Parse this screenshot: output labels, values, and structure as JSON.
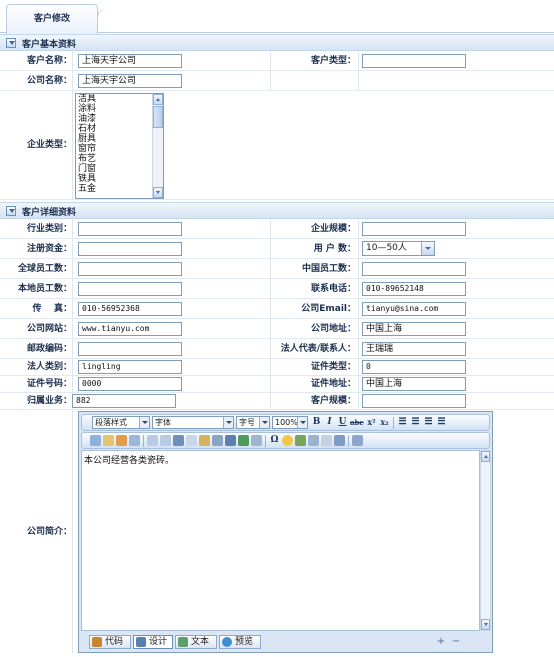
{
  "tab": {
    "title": "客户修改"
  },
  "sections": {
    "basic": "客户基本资料",
    "detail": "客户详细资料"
  },
  "basic": {
    "customer_name_label": "客户名称：",
    "customer_name": "上海天宇公司",
    "customer_type_label": "客户类型：",
    "customer_type": "",
    "company_name_label": "公司名称：",
    "company_name": "上海天宇公司",
    "industry_type_label": "企业类型：",
    "industry_options": [
      "洁具",
      "涂料",
      "油漆",
      "石材",
      "厨具",
      "窗帘",
      "布艺",
      "门窗",
      "铁具",
      "五金"
    ]
  },
  "detail": {
    "industry_label": "行业类别：",
    "industry": "",
    "scale_label": "企业规模：",
    "scale": "",
    "capital_label": "注册资金：",
    "capital": "",
    "users_label": "用 户 数：",
    "users": "10—50人",
    "global_staff_label": "全球员工数：",
    "global_staff": "",
    "china_staff_label": "中国员工数：",
    "china_staff": "",
    "local_staff_label": "本地员工数：",
    "local_staff": "",
    "phone_label": "联系电话：",
    "phone": "010-89652148",
    "fax_label": "传    真：",
    "fax": "010-56952368",
    "email_label": "公司Email：",
    "email": "tianyu@sina.com",
    "website_label": "公司网站：",
    "website": "www.tianyu.com",
    "address_label": "公司地址：",
    "address": "中国上海",
    "zip_label": "邮政编码：",
    "zip": "",
    "legal_label": "法人代表/联系人：",
    "legal": "王瑞瑞",
    "legal_type_label": "法人类别：",
    "legal_type": "lingling",
    "cert_type_label": "证件类型：",
    "cert_type": "0",
    "cert_no_label": "证件号码：",
    "cert_no": "0000",
    "cert_addr_label": "证件地址：",
    "cert_addr": "中国上海",
    "owner_label": "归属业务：",
    "owner": "882",
    "cust_scale_label": "客户规模：",
    "cust_scale": "",
    "intro_label": "公司简介："
  },
  "editor": {
    "para_style": "段落样式",
    "font": "字体",
    "font_size": "字号",
    "zoom": "100%",
    "content": "本公司经营各类瓷砖。",
    "modes": [
      "代码",
      "设计",
      "文本",
      "预览"
    ]
  },
  "colors": {
    "accent": "#3a6aa6",
    "label": "#1d2f4f",
    "border": "#7f9db9"
  }
}
